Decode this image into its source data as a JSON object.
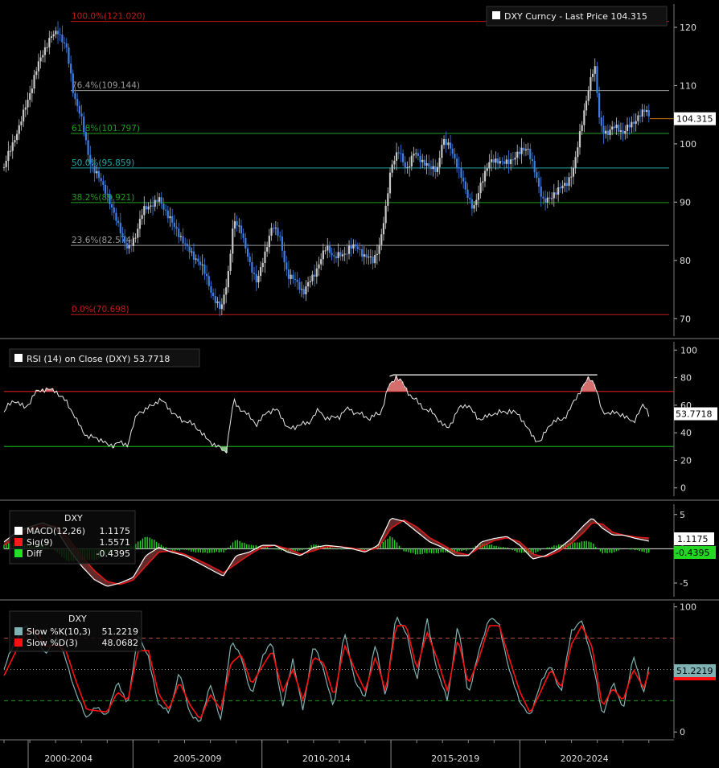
{
  "colors": {
    "background": "#000000",
    "separator": "#555555",
    "price_up": "#c8c8c8",
    "price_down": "#3d7fe6",
    "fib_red": "#c21a1a",
    "fib_white": "#9a9a9a",
    "fib_green": "#1f9e1f",
    "fib_teal": "#21a7a7",
    "rsi_line": "#e8e8e8",
    "rsi_upper": "#c21a1a",
    "rsi_lower": "#16a316",
    "rsi_fill_over": "#d66e6e",
    "rsi_fill_under": "#7fc47f",
    "macd_line": "#ffffff",
    "sig_line": "#e01818",
    "diff_bar": "#22d622",
    "stoch_k": "#7fb2b2",
    "stoch_d": "#ff1010",
    "stoch_upper": "#b84b33",
    "stoch_lower": "#1f9e1f",
    "price_label_bg": "#ffffff",
    "price_label_border": "#d6781a"
  },
  "chart_data": [
    {
      "type": "candlestick",
      "panel": "price",
      "legend": "DXY Curncy - Last Price 104.315",
      "last_value_label": "104.315",
      "last_value": 104.315,
      "ylim": [
        67,
        124
      ],
      "yticks": [
        70,
        80,
        90,
        100,
        110,
        120
      ],
      "x_start_year": 2000,
      "x_end_year": 2025.1,
      "xtick_labels": [
        "2000-2004",
        "2005-2009",
        "2010-2014",
        "2015-2019",
        "2020-2024"
      ],
      "fib_levels": [
        {
          "label": "100.0%(121.020)",
          "value": 121.02,
          "color": "fib_red"
        },
        {
          "label": "76.4%(109.144)",
          "value": 109.144,
          "color": "fib_white"
        },
        {
          "label": "61.8%(101.797)",
          "value": 101.797,
          "color": "fib_green"
        },
        {
          "label": "50.0%(95.859)",
          "value": 95.859,
          "color": "fib_teal"
        },
        {
          "label": "38.2%(89.921)",
          "value": 89.921,
          "color": "fib_green"
        },
        {
          "label": "23.6%(82.574)",
          "value": 82.574,
          "color": "fib_white"
        },
        {
          "label": "0.0%(70.698)",
          "value": 70.698,
          "color": "fib_red"
        }
      ],
      "series": [
        {
          "x": [
            2000.0,
            2000.3,
            2000.6,
            2000.9,
            2001.2,
            2001.5,
            2001.8,
            2002.1,
            2002.4,
            2002.7,
            2003.0,
            2003.3,
            2003.6,
            2003.9,
            2004.2,
            2004.5,
            2004.8,
            2005.1,
            2005.4,
            2005.7,
            2006.0,
            2006.3,
            2006.6,
            2006.9,
            2007.2,
            2007.5,
            2007.8,
            2008.1,
            2008.4,
            2008.7,
            2008.9,
            2009.2,
            2009.5,
            2009.8,
            2010.1,
            2010.4,
            2010.7,
            2011.0,
            2011.3,
            2011.6,
            2011.9,
            2012.2,
            2012.5,
            2012.8,
            2013.1,
            2013.4,
            2013.7,
            2014.0,
            2014.3,
            2014.6,
            2014.8,
            2015.0,
            2015.3,
            2015.6,
            2015.9,
            2016.2,
            2016.5,
            2016.8,
            2017.0,
            2017.3,
            2017.6,
            2017.9,
            2018.2,
            2018.5,
            2018.8,
            2019.1,
            2019.4,
            2019.7,
            2020.0,
            2020.3,
            2020.6,
            2020.9,
            2021.2,
            2021.5,
            2021.8,
            2022.1,
            2022.4,
            2022.7,
            2022.9,
            2023.1,
            2023.4,
            2023.7,
            2024.0,
            2024.3,
            2024.6,
            2024.9,
            2025.0
          ],
          "values": [
            96,
            99,
            103,
            108,
            112,
            115,
            118,
            120,
            117,
            108,
            104,
            98,
            95,
            92,
            88,
            86,
            82,
            84,
            88,
            90,
            91,
            88,
            85,
            84,
            82,
            80,
            77,
            74,
            72,
            78,
            86,
            85,
            80,
            77,
            80,
            86,
            84,
            78,
            76,
            74,
            77,
            80,
            82,
            80,
            81,
            83,
            82,
            80,
            80,
            84,
            89,
            96,
            98,
            96,
            99,
            97,
            95,
            96,
            101,
            100,
            95,
            92,
            89,
            94,
            96,
            97,
            97,
            98,
            98,
            99,
            95,
            91,
            90,
            92,
            93,
            97,
            103,
            110,
            113,
            104,
            102,
            103,
            101,
            104,
            105,
            106,
            104.3
          ]
        }
      ]
    },
    {
      "type": "line",
      "panel": "rsi",
      "legend": "RSI (14)  on Close (DXY) 53.7718",
      "last_value_label": "53.7718",
      "last_value": 53.7718,
      "ylim": [
        -6,
        106
      ],
      "yticks": [
        0,
        20,
        40,
        60,
        80,
        100
      ],
      "upper": 70,
      "lower": 30,
      "series": [
        {
          "x": [
            2000.0,
            2000.4,
            2000.8,
            2001.2,
            2001.6,
            2002.0,
            2002.4,
            2002.8,
            2003.2,
            2003.6,
            2004.0,
            2004.4,
            2004.8,
            2005.2,
            2005.6,
            2006.0,
            2006.4,
            2006.8,
            2007.2,
            2007.6,
            2008.0,
            2008.3,
            2008.6,
            2008.9,
            2009.2,
            2009.5,
            2009.8,
            2010.2,
            2010.6,
            2011.0,
            2011.4,
            2011.8,
            2012.2,
            2012.6,
            2013.0,
            2013.4,
            2013.8,
            2014.2,
            2014.6,
            2014.9,
            2015.2,
            2015.6,
            2016.0,
            2016.4,
            2016.8,
            2017.2,
            2017.6,
            2018.0,
            2018.4,
            2018.8,
            2019.2,
            2019.6,
            2020.0,
            2020.4,
            2020.8,
            2021.2,
            2021.6,
            2022.0,
            2022.4,
            2022.7,
            2022.9,
            2023.2,
            2023.6,
            2024.0,
            2024.4,
            2024.8,
            2025.0
          ],
          "values": [
            55,
            62,
            60,
            68,
            70,
            73,
            62,
            48,
            40,
            35,
            30,
            35,
            30,
            55,
            60,
            62,
            58,
            52,
            45,
            42,
            35,
            28,
            24,
            65,
            58,
            50,
            45,
            58,
            55,
            42,
            48,
            45,
            56,
            52,
            50,
            58,
            55,
            48,
            55,
            75,
            80,
            70,
            65,
            55,
            50,
            45,
            55,
            60,
            52,
            50,
            55,
            58,
            50,
            40,
            35,
            45,
            50,
            60,
            70,
            80,
            78,
            55,
            52,
            55,
            48,
            58,
            53.77
          ]
        }
      ]
    },
    {
      "type": "line",
      "panel": "macd",
      "legend_title": "DXY",
      "legend": [
        {
          "name": "MACD(12,26)",
          "value": "1.1175"
        },
        {
          "name": "Sig(9)",
          "value": "1.5571"
        },
        {
          "name": "Diff",
          "value": "-0.4395"
        }
      ],
      "last_value_labels": [
        "1.1175",
        "-0.4395"
      ],
      "ylim": [
        -7,
        6.5
      ],
      "yticks": [
        -5,
        0,
        5
      ],
      "series": [
        {
          "name": "MACD(12,26)",
          "x": [
            2000.0,
            2000.5,
            2001.0,
            2001.5,
            2002.0,
            2002.5,
            2003.0,
            2003.5,
            2004.0,
            2004.5,
            2005.0,
            2005.5,
            2006.0,
            2006.5,
            2007.0,
            2007.5,
            2008.0,
            2008.5,
            2009.0,
            2009.5,
            2010.0,
            2010.5,
            2011.0,
            2011.5,
            2012.0,
            2012.5,
            2013.0,
            2013.5,
            2014.0,
            2014.5,
            2015.0,
            2015.5,
            2016.0,
            2016.5,
            2017.0,
            2017.5,
            2018.0,
            2018.5,
            2019.0,
            2019.5,
            2020.0,
            2020.5,
            2021.0,
            2021.5,
            2022.0,
            2022.5,
            2022.8,
            2023.2,
            2023.6,
            2024.0,
            2024.5,
            2025.0
          ],
          "values": [
            1.0,
            2.5,
            3.2,
            3.8,
            3.0,
            0.0,
            -2.5,
            -4.5,
            -5.5,
            -5.0,
            -4.2,
            -1.0,
            0.2,
            -0.5,
            -1.0,
            -2.0,
            -3.0,
            -4.0,
            -1.0,
            -0.5,
            0.5,
            0.5,
            -0.5,
            -1.0,
            0.2,
            0.5,
            0.3,
            0.0,
            -0.5,
            0.5,
            4.5,
            4.0,
            2.5,
            1.0,
            0.2,
            -1.0,
            -1.0,
            1.0,
            1.5,
            1.8,
            0.5,
            -1.5,
            -1.0,
            0.0,
            1.5,
            3.5,
            4.5,
            3.0,
            2.0,
            2.0,
            1.5,
            1.1175
          ]
        },
        {
          "name": "Sig(9)",
          "x": [
            2000.0,
            2000.5,
            2001.0,
            2001.5,
            2002.0,
            2002.5,
            2003.0,
            2003.5,
            2004.0,
            2004.5,
            2005.0,
            2005.5,
            2006.0,
            2006.5,
            2007.0,
            2007.5,
            2008.0,
            2008.5,
            2009.0,
            2009.5,
            2010.0,
            2010.5,
            2011.0,
            2011.5,
            2012.0,
            2012.5,
            2013.0,
            2013.5,
            2014.0,
            2014.5,
            2015.0,
            2015.5,
            2016.0,
            2016.5,
            2017.0,
            2017.5,
            2018.0,
            2018.5,
            2019.0,
            2019.5,
            2020.0,
            2020.5,
            2021.0,
            2021.5,
            2022.0,
            2022.5,
            2022.8,
            2023.2,
            2023.6,
            2024.0,
            2024.5,
            2025.0
          ],
          "values": [
            0.5,
            1.8,
            2.8,
            3.4,
            3.3,
            1.5,
            -1.0,
            -3.2,
            -4.8,
            -5.2,
            -4.6,
            -2.5,
            -0.5,
            -0.3,
            -0.8,
            -1.6,
            -2.5,
            -3.5,
            -2.2,
            -0.9,
            0.2,
            0.5,
            0.0,
            -0.8,
            -0.3,
            0.3,
            0.3,
            0.1,
            -0.3,
            0.1,
            3.0,
            4.2,
            3.2,
            1.6,
            0.6,
            -0.5,
            -0.9,
            0.3,
            1.2,
            1.6,
            1.0,
            -0.8,
            -1.2,
            -0.4,
            0.8,
            2.5,
            3.8,
            3.6,
            2.4,
            2.0,
            1.7,
            1.5571
          ]
        }
      ]
    },
    {
      "type": "line",
      "panel": "stochastic",
      "legend_title": "DXY",
      "legend": [
        {
          "name": "Slow %K(10,3)",
          "value": "51.2219"
        },
        {
          "name": "Slow %D(3)",
          "value": "48.0682"
        }
      ],
      "last_value_label": "51.2219",
      "ylim": [
        -5,
        103
      ],
      "yticks": [
        0,
        100
      ],
      "upper": 75,
      "lower": 25,
      "series": [
        {
          "name": "Slow %K(10,3)",
          "x": [
            2000.0,
            2000.4,
            2000.8,
            2001.2,
            2001.6,
            2002.0,
            2002.4,
            2002.8,
            2003.2,
            2003.6,
            2004.0,
            2004.4,
            2004.8,
            2005.2,
            2005.6,
            2006.0,
            2006.4,
            2006.8,
            2007.2,
            2007.6,
            2008.0,
            2008.4,
            2008.8,
            2009.2,
            2009.6,
            2010.0,
            2010.4,
            2010.8,
            2011.2,
            2011.6,
            2012.0,
            2012.4,
            2012.8,
            2013.2,
            2013.6,
            2014.0,
            2014.4,
            2014.8,
            2015.2,
            2015.6,
            2016.0,
            2016.4,
            2016.8,
            2017.2,
            2017.6,
            2018.0,
            2018.4,
            2018.8,
            2019.2,
            2019.6,
            2020.0,
            2020.4,
            2020.8,
            2021.2,
            2021.6,
            2022.0,
            2022.4,
            2022.8,
            2023.2,
            2023.6,
            2024.0,
            2024.4,
            2024.8,
            2025.0
          ],
          "values": [
            50,
            70,
            85,
            80,
            60,
            75,
            60,
            30,
            10,
            20,
            15,
            40,
            20,
            80,
            60,
            20,
            15,
            50,
            15,
            5,
            40,
            10,
            70,
            60,
            30,
            60,
            70,
            20,
            60,
            15,
            70,
            50,
            20,
            80,
            40,
            30,
            70,
            25,
            95,
            80,
            40,
            90,
            50,
            25,
            85,
            30,
            65,
            90,
            85,
            50,
            25,
            10,
            40,
            55,
            30,
            80,
            90,
            60,
            10,
            40,
            20,
            60,
            30,
            51.22
          ]
        },
        {
          "name": "Slow %D(3)",
          "x": [
            2000.0,
            2000.4,
            2000.8,
            2001.2,
            2001.6,
            2002.0,
            2002.4,
            2002.8,
            2003.2,
            2003.6,
            2004.0,
            2004.4,
            2004.8,
            2005.2,
            2005.6,
            2006.0,
            2006.4,
            2006.8,
            2007.2,
            2007.6,
            2008.0,
            2008.4,
            2008.8,
            2009.2,
            2009.6,
            2010.0,
            2010.4,
            2010.8,
            2011.2,
            2011.6,
            2012.0,
            2012.4,
            2012.8,
            2013.2,
            2013.6,
            2014.0,
            2014.4,
            2014.8,
            2015.2,
            2015.6,
            2016.0,
            2016.4,
            2016.8,
            2017.2,
            2017.6,
            2018.0,
            2018.4,
            2018.8,
            2019.2,
            2019.6,
            2020.0,
            2020.4,
            2020.8,
            2021.2,
            2021.6,
            2022.0,
            2022.4,
            2022.8,
            2023.2,
            2023.6,
            2024.0,
            2024.4,
            2024.8,
            2025.0
          ],
          "values": [
            45,
            62,
            78,
            82,
            68,
            70,
            65,
            40,
            18,
            17,
            16,
            32,
            25,
            65,
            65,
            30,
            18,
            40,
            22,
            10,
            30,
            18,
            55,
            62,
            38,
            52,
            65,
            32,
            50,
            25,
            60,
            55,
            28,
            70,
            50,
            33,
            60,
            32,
            85,
            85,
            50,
            80,
            58,
            32,
            75,
            38,
            58,
            85,
            85,
            58,
            32,
            15,
            32,
            50,
            35,
            70,
            85,
            68,
            20,
            35,
            25,
            50,
            35,
            48.07
          ]
        }
      ]
    }
  ]
}
